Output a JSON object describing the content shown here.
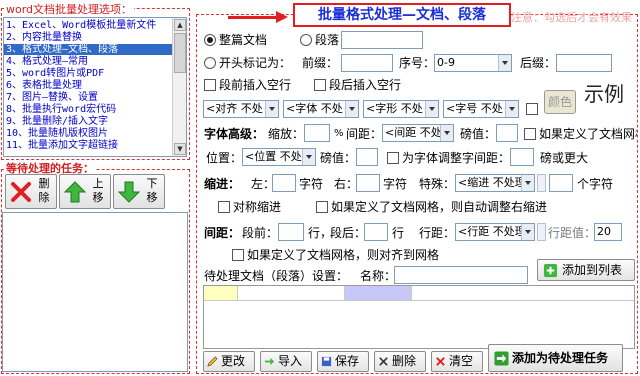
{
  "left_panel": {
    "options_title": "word文档批量处理选项：",
    "list_items": [
      "1、Excel、Word模板批量新文件",
      "2、内容批量替换",
      "3、格式处理—文档、段落",
      "4、格式处理—常用",
      "5、word转图片或PDF",
      "6、表格批量处理",
      "7、图片—替换、设置",
      "8、批量执行word宏代码",
      "9、批量删除/插入文字",
      "10、批量随机版权图片",
      "11、批量添加文字超链接"
    ],
    "selected_index": 2,
    "tasks_title": "等待处理的任务：",
    "buttons": {
      "delete": "删除",
      "move_up": "上移",
      "move_down": "下移"
    }
  },
  "banner": {
    "title": "批量格式处理—文档、段落",
    "note": "注意：勾选后才会有效果"
  },
  "scope": {
    "whole_doc": "整篇文档",
    "paragraph": "段落",
    "starts_with": "开头标记为：",
    "prefix": "前缀：",
    "seq_label": "序号：",
    "seq_value": "0-9",
    "suffix": "后缀："
  },
  "insert": {
    "before": "段前插入空行",
    "after": "段后插入空行"
  },
  "format_row": {
    "align": "<对齐 不处",
    "font": "<字体 不处",
    "shape": "<字形 不处",
    "size": "<字号 不处",
    "color_btn": "颜色",
    "preview": "示例"
  },
  "font_adv": {
    "label": "字体高级：",
    "scale": "缩放：",
    "percent": "%",
    "spacing": "间距：",
    "spacing_val": "<间距 不处",
    "pounds": "磅值：",
    "grid_opt": "如果定义了文档网格",
    "position": "位置：",
    "position_val": "<位置 不处",
    "pounds2": "磅值：",
    "adjust": "为字体调整字间距：",
    "or_more": "磅或更大"
  },
  "indent": {
    "label": "缩进：",
    "left": "左：",
    "unit1": "字符",
    "right": "右：",
    "unit2": "字符",
    "special": "特殊：",
    "special_val": "<缩进 不处理",
    "unit3": "个字符",
    "symmetric": "对称缩进",
    "grid_opt": "如果定义了文档网格，则自动调整右缩进"
  },
  "spacing": {
    "label": "间距：",
    "before": "段前：",
    "unit1": "行，",
    "after": "段后：",
    "unit2": "行",
    "line": "行距：",
    "line_val": "<行距 不处理",
    "line_pounds": "行距值：",
    "line_pounds_val": "20",
    "grid_opt": "如果定义了文档网格，则对齐到网格"
  },
  "task_settings": {
    "label": "待处理文档（段落）设置：",
    "name": "名称：",
    "add_to_list": "添加到列表"
  },
  "bottom_buttons": {
    "edit": "更改",
    "import": "导入",
    "save": "保存",
    "delete": "删除",
    "clear": "清空",
    "add_task": "添加为待处理任务"
  },
  "colors": {
    "accent_red": "#e02020",
    "banner_blue": "#1b2fd8",
    "selection": "#3169c6",
    "grid_yellow": "#ffffc0",
    "grid_purple": "#c8c8f8"
  }
}
